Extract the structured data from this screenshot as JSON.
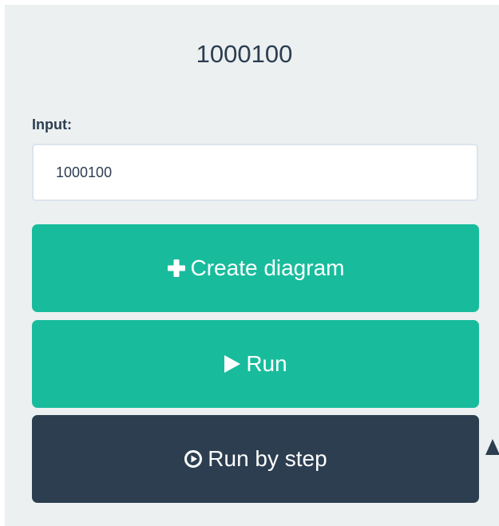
{
  "header": {
    "title": "1000100"
  },
  "form": {
    "input_label": "Input:",
    "input_value": "1000100",
    "input_placeholder": ""
  },
  "buttons": {
    "create_label": "Create diagram",
    "run_label": "Run",
    "step_label": "Run by step"
  },
  "icons": {
    "create": "plus-icon",
    "run": "play-icon",
    "step": "play-circle-icon"
  },
  "colors": {
    "panel_background": "#ecf0f1",
    "primary_green": "#18bc9c",
    "dark_navy": "#2c3e50",
    "text": "#2c3e50"
  }
}
